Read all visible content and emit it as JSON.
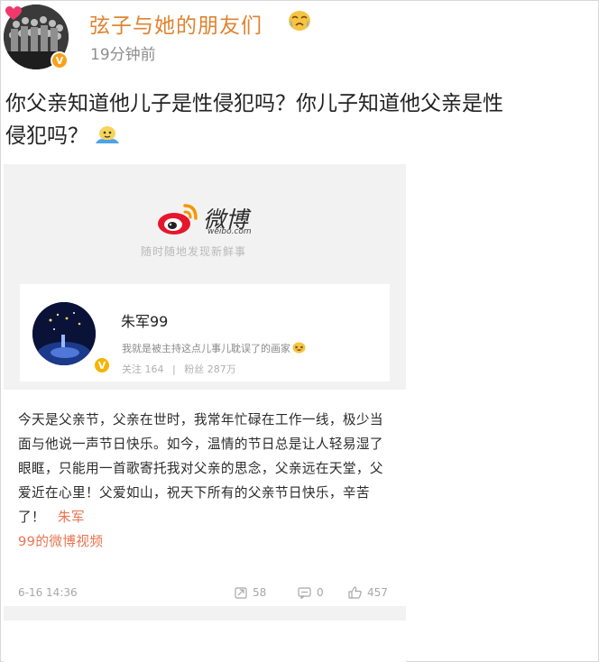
{
  "post": {
    "author": "弦子与她的朋友们",
    "time": "19分钟前",
    "text_line1": "你父亲知道他儿子是性侵犯吗？你儿子知道他父亲是性",
    "text_line2": "侵犯吗？",
    "author_emoji": "crying-face-icon",
    "inline_emoji": "thinking-face-icon"
  },
  "embed": {
    "brand": "微博",
    "domain": "weibo.com",
    "slogan": "随时随地发现新鲜事",
    "user": {
      "name": "朱军99",
      "bio": "我就是被主持这点儿事儿耽误了的画家",
      "follow_label": "关注",
      "follow_count": "164",
      "fans_label": "粉丝",
      "fans_count": "287万"
    },
    "body": {
      "text": "今天是父亲节，父亲在世时，我常年忙碌在工作一线，极少当面与他说一声节日快乐。如今，温情的节日总是让人轻易湿了眼眶，只能用一首歌寄托我对父亲的思念，父亲远在天堂，父爱近在心里！父爱如山，祝天下所有的父亲节日快乐，辛苦了！",
      "link_part1": "朱军",
      "link_part2": "99的微博视频",
      "date": "6-16 14:36",
      "reposts": "58",
      "comments": "0",
      "likes": "457"
    }
  },
  "colors": {
    "author_orange": "#e0832f",
    "link_orange": "#eb7350",
    "vip_badge": "#f7a11a",
    "weibo_red": "#e6162d"
  }
}
